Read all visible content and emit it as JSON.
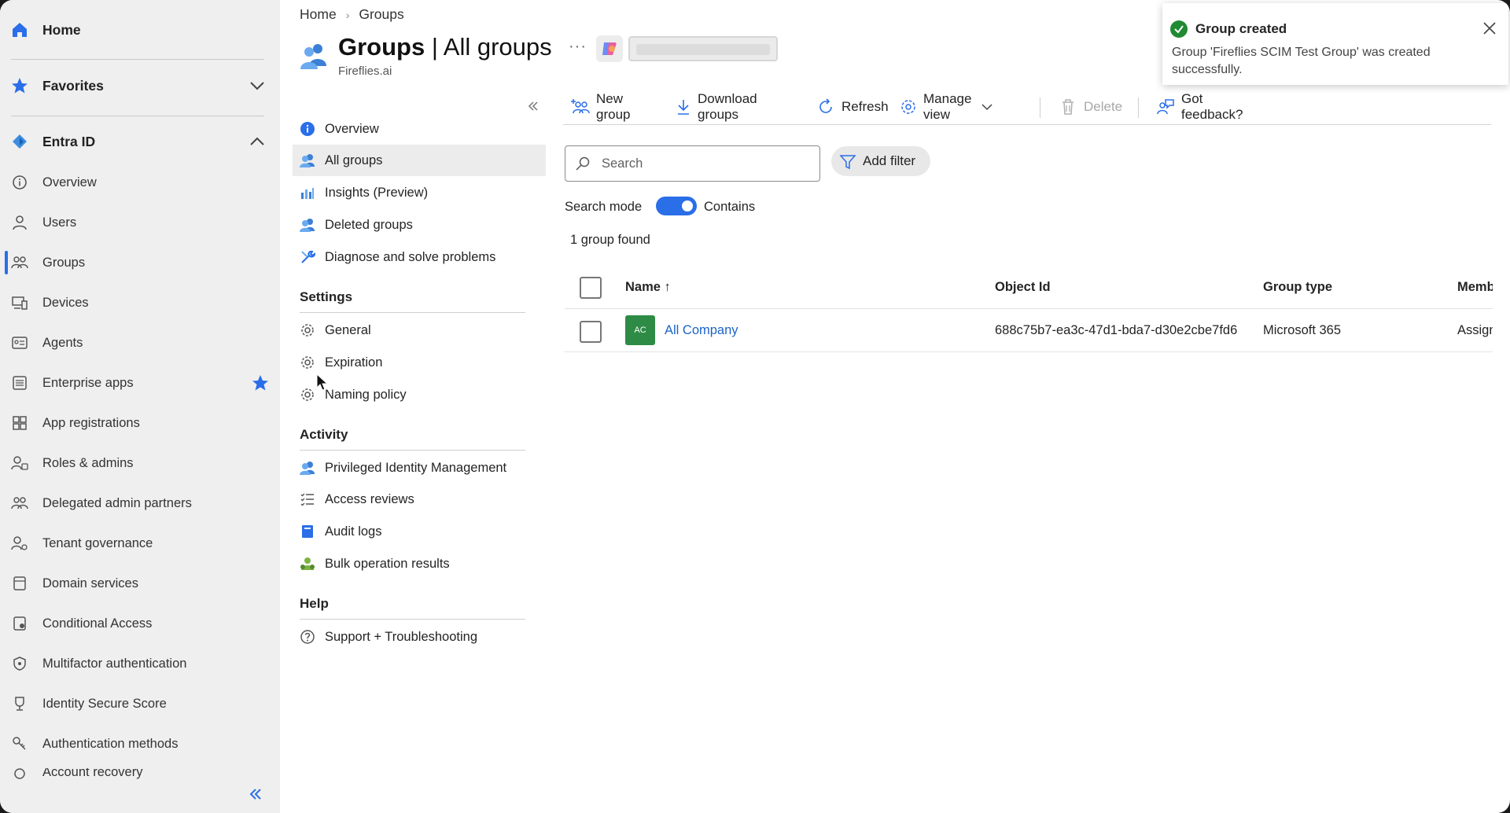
{
  "leftnav": {
    "home": "Home",
    "favorites": "Favorites",
    "entra": "Entra ID",
    "items": [
      {
        "label": "Overview"
      },
      {
        "label": "Users"
      },
      {
        "label": "Groups"
      },
      {
        "label": "Devices"
      },
      {
        "label": "Agents"
      },
      {
        "label": "Enterprise apps"
      },
      {
        "label": "App registrations"
      },
      {
        "label": "Roles & admins"
      },
      {
        "label": "Delegated admin partners"
      },
      {
        "label": "Tenant governance"
      },
      {
        "label": "Domain services"
      },
      {
        "label": "Conditional Access"
      },
      {
        "label": "Multifactor authentication"
      },
      {
        "label": "Identity Secure Score"
      },
      {
        "label": "Authentication methods"
      },
      {
        "label": "Account recovery"
      }
    ]
  },
  "breadcrumb": {
    "home": "Home",
    "current": "Groups"
  },
  "header": {
    "title_bold": "Groups",
    "title_rest": " | All groups",
    "subtitle": "Fireflies.ai",
    "more": "···"
  },
  "blade_menu": {
    "top": [
      {
        "label": "Overview"
      },
      {
        "label": "All groups"
      },
      {
        "label": "Insights (Preview)"
      },
      {
        "label": "Deleted groups"
      },
      {
        "label": "Diagnose and solve problems"
      }
    ],
    "settings_title": "Settings",
    "settings": [
      {
        "label": "General"
      },
      {
        "label": "Expiration"
      },
      {
        "label": "Naming policy"
      }
    ],
    "activity_title": "Activity",
    "activity": [
      {
        "label": "Privileged Identity Management"
      },
      {
        "label": "Access reviews"
      },
      {
        "label": "Audit logs"
      },
      {
        "label": "Bulk operation results"
      }
    ],
    "help_title": "Help",
    "help": [
      {
        "label": "Support + Troubleshooting"
      }
    ]
  },
  "toolbar": {
    "new_group": "New group",
    "download": "Download groups",
    "refresh": "Refresh",
    "manage_view": "Manage view",
    "delete": "Delete",
    "feedback": "Got feedback?"
  },
  "search": {
    "placeholder": "Search",
    "add_filter": "Add filter"
  },
  "search_mode": {
    "label": "Search mode",
    "value": "Contains"
  },
  "result_count": "1 group found",
  "table": {
    "columns": [
      "Name ↑",
      "Object Id",
      "Group type",
      "Memb"
    ],
    "rows": [
      {
        "initials": "AC",
        "name": "All Company",
        "object_id": "688c75b7-ea3c-47d1-bda7-d30e2cbe7fd6",
        "group_type": "Microsoft 365",
        "membership": "Assign"
      }
    ]
  },
  "toast": {
    "title": "Group created",
    "message": "Group 'Fireflies SCIM Test Group' was created successfully."
  },
  "colors": {
    "accent": "#2a6ee8",
    "success": "#1f8a32",
    "avatar": "#2e8b45",
    "link": "#1c63c7"
  }
}
